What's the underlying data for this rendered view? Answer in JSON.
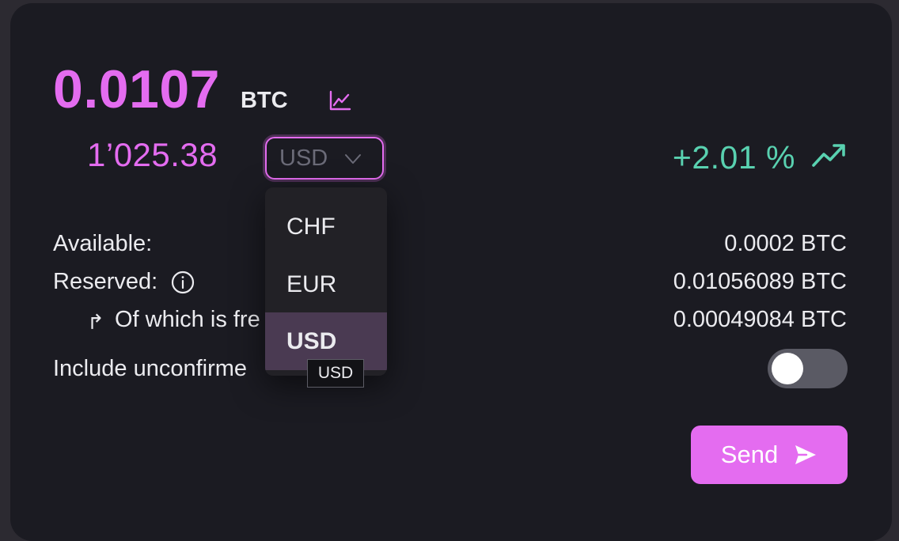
{
  "balance": {
    "amount": "0.0107",
    "unit": "BTC",
    "chart_icon": "line-chart-icon"
  },
  "fiat": {
    "amount": "1’025.38",
    "selected_currency": "USD",
    "chevron_icon": "chevron-down-icon"
  },
  "change": {
    "text": "+2.01 %",
    "trend_icon": "trending-up-icon"
  },
  "rows": {
    "available_label": "Available:",
    "available_value": "0.0002 BTC",
    "reserved_label": "Reserved:",
    "reserved_value": "0.01056089 BTC",
    "freezable_label": "Of which is fre",
    "freezable_value": "0.00049084 BTC",
    "unconfirmed_label": "Include unconfirme"
  },
  "toggle": {
    "on": false
  },
  "send_button": {
    "label": "Send",
    "icon": "paper-plane-icon"
  },
  "dropdown": {
    "options": [
      {
        "label": "CHF",
        "selected": false
      },
      {
        "label": "EUR",
        "selected": false
      },
      {
        "label": "USD",
        "selected": true
      }
    ],
    "tooltip": "USD"
  },
  "colors": {
    "accent": "#e46cf0",
    "positive": "#59d1b0",
    "card_bg": "#1b1b22",
    "text": "#ebebef"
  }
}
